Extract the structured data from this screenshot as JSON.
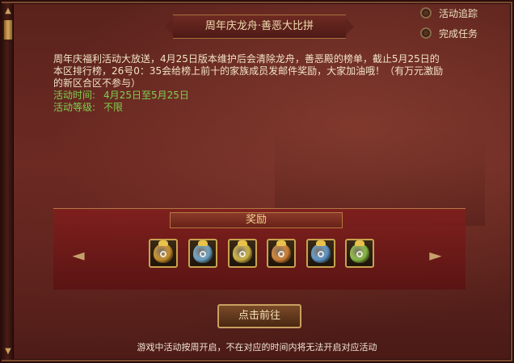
{
  "title": "周年庆龙舟·善恶大比拼",
  "side_buttons": [
    {
      "label": "活动追踪"
    },
    {
      "label": "完成任务"
    }
  ],
  "description": "周年庆福利活动大放送，4月25日版本维护后会清除龙舟，善恶殿的榜单，截止5月25日的本区排行榜，26号0：35会给榜上前十的家族成员发邮件奖励，大家加油哦！（有万元激励的新区合区不参与）",
  "activity_time": {
    "label": "活动时间:",
    "value": "4月25日至5月25日"
  },
  "activity_level": {
    "label": "活动等级:",
    "value": "不限"
  },
  "reward": {
    "header": "奖励",
    "items": [
      {
        "icon": "gold-bag-icon",
        "color": "#e0a030"
      },
      {
        "icon": "blue-bag-icon",
        "color": "#7ab6dc"
      },
      {
        "icon": "yellow-bag-icon",
        "color": "#e6c84a"
      },
      {
        "icon": "orange-bag-icon",
        "color": "#e8903a"
      },
      {
        "icon": "blue-bag-icon",
        "color": "#6aa8e0"
      },
      {
        "icon": "green-bag-icon",
        "color": "#9ad04e"
      }
    ]
  },
  "go_button": "点击前往",
  "footer": "游戏中活动按周开启，不在对应的时间内将无法开启对应活动",
  "colors": {
    "accent_green": "#7fd04e",
    "gold": "#c9a24e"
  }
}
